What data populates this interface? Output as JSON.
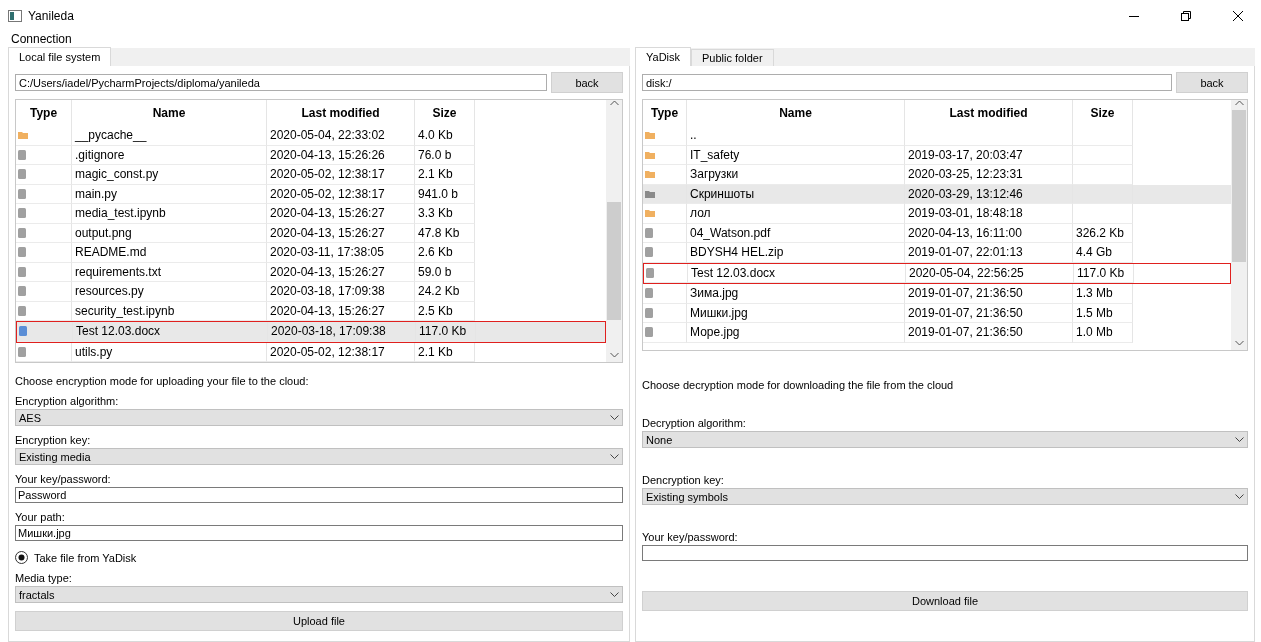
{
  "window": {
    "title": "Yanileda"
  },
  "menu": [
    "Connection"
  ],
  "left": {
    "tabs": [
      {
        "label": "Local file system",
        "selected": true
      }
    ],
    "path": "C:/Users/iadel/PycharmProjects/diploma/yanileda",
    "back": "back",
    "columns": [
      "Type",
      "Name",
      "Last modified",
      "Size"
    ],
    "rows": [
      {
        "kind": "folder",
        "name": "__pycache__",
        "modified": "2020-05-04, 22:33:02",
        "size": "4.0 Kb",
        "selected": false,
        "highlighted": false
      },
      {
        "kind": "file",
        "name": ".gitignore",
        "modified": "2020-04-13, 15:26:26",
        "size": "76.0 b",
        "selected": false,
        "highlighted": false
      },
      {
        "kind": "file",
        "name": "magic_const.py",
        "modified": "2020-05-02, 12:38:17",
        "size": "2.1 Kb",
        "selected": false,
        "highlighted": false
      },
      {
        "kind": "file",
        "name": "main.py",
        "modified": "2020-05-02, 12:38:17",
        "size": "941.0 b",
        "selected": false,
        "highlighted": false
      },
      {
        "kind": "file",
        "name": "media_test.ipynb",
        "modified": "2020-04-13, 15:26:27",
        "size": "3.3 Kb",
        "selected": false,
        "highlighted": false
      },
      {
        "kind": "file",
        "name": "output.png",
        "modified": "2020-04-13, 15:26:27",
        "size": "47.8 Kb",
        "selected": false,
        "highlighted": false
      },
      {
        "kind": "file",
        "name": "README.md",
        "modified": "2020-03-11, 17:38:05",
        "size": "2.6 Kb",
        "selected": false,
        "highlighted": false
      },
      {
        "kind": "file",
        "name": "requirements.txt",
        "modified": "2020-04-13, 15:26:27",
        "size": "59.0 b",
        "selected": false,
        "highlighted": false
      },
      {
        "kind": "file",
        "name": "resources.py",
        "modified": "2020-03-18, 17:09:38",
        "size": "24.2 Kb",
        "selected": false,
        "highlighted": false
      },
      {
        "kind": "file",
        "name": "security_test.ipynb",
        "modified": "2020-04-13, 15:26:27",
        "size": "2.5 Kb",
        "selected": false,
        "highlighted": false
      },
      {
        "kind": "file",
        "name": "Test 12.03.docx",
        "modified": "2020-03-18, 17:09:38",
        "size": "117.0 Kb",
        "selected": true,
        "highlighted": true
      },
      {
        "kind": "file",
        "name": "utils.py",
        "modified": "2020-05-02, 12:38:17",
        "size": "2.1 Kb",
        "selected": false,
        "highlighted": false
      }
    ],
    "prompt": "Choose encryption mode for uploading your file to the cloud:",
    "form": [
      {
        "kind": "select",
        "label": "Encryption algorithm:",
        "value": "AES"
      },
      {
        "kind": "select",
        "label": "Encryption key:",
        "value": "Existing media"
      },
      {
        "kind": "input",
        "label": "Your key/password:",
        "value": "Password"
      },
      {
        "kind": "input",
        "label": "Your path:",
        "value": "Мишки.jpg"
      },
      {
        "kind": "radio",
        "label": "Take file from YaDisk",
        "selected": true
      },
      {
        "kind": "select",
        "label": "Media type:",
        "value": "fractals"
      }
    ],
    "action": "Upload file"
  },
  "right": {
    "tabs": [
      {
        "label": "YaDisk",
        "selected": true
      },
      {
        "label": "Public folder",
        "selected": false
      }
    ],
    "path": "disk:/",
    "back": "back",
    "columns": [
      "Type",
      "Name",
      "Last modified",
      "Size"
    ],
    "rows": [
      {
        "kind": "folder",
        "name": "..",
        "modified": "",
        "size": "",
        "selected": false,
        "highlighted": false
      },
      {
        "kind": "folder",
        "name": "IT_safety",
        "modified": "2019-03-17, 20:03:47",
        "size": "",
        "selected": false,
        "highlighted": false
      },
      {
        "kind": "folder",
        "name": "Загрузки",
        "modified": "2020-03-25, 12:23:31",
        "size": "",
        "selected": false,
        "highlighted": false
      },
      {
        "kind": "folder",
        "name": "Скриншоты",
        "modified": "2020-03-29, 13:12:46",
        "size": "",
        "selected": true,
        "highlighted": false
      },
      {
        "kind": "folder",
        "name": "лол",
        "modified": "2019-03-01, 18:48:18",
        "size": "",
        "selected": false,
        "highlighted": false
      },
      {
        "kind": "file",
        "name": "04_Watson.pdf",
        "modified": "2020-04-13, 16:11:00",
        "size": "326.2 Kb",
        "selected": false,
        "highlighted": false
      },
      {
        "kind": "file",
        "name": "BDYSH4 HEL.zip",
        "modified": "2019-01-07, 22:01:13",
        "size": "4.4 Gb",
        "selected": false,
        "highlighted": false
      },
      {
        "kind": "file",
        "name": "Test 12.03.docx",
        "modified": "2020-05-04, 22:56:25",
        "size": "117.0 Kb",
        "selected": false,
        "highlighted": true
      },
      {
        "kind": "file",
        "name": "Зима.jpg",
        "modified": "2019-01-07, 21:36:50",
        "size": "1.3 Mb",
        "selected": false,
        "highlighted": false
      },
      {
        "kind": "file",
        "name": "Мишки.jpg",
        "modified": "2019-01-07, 21:36:50",
        "size": "1.5 Mb",
        "selected": false,
        "highlighted": false
      },
      {
        "kind": "file",
        "name": "Море.jpg",
        "modified": "2019-01-07, 21:36:50",
        "size": "1.0 Mb",
        "selected": false,
        "highlighted": false
      }
    ],
    "prompt": "Choose decryption mode for downloading the file from the cloud",
    "form": [
      {
        "kind": "select",
        "label": "Decryption algorithm:",
        "value": "None"
      },
      {
        "kind": "select",
        "label": "Dencryption key:",
        "value": "Existing symbols"
      },
      {
        "kind": "input",
        "label": "Your key/password:"
      }
    ],
    "action": "Download file"
  }
}
